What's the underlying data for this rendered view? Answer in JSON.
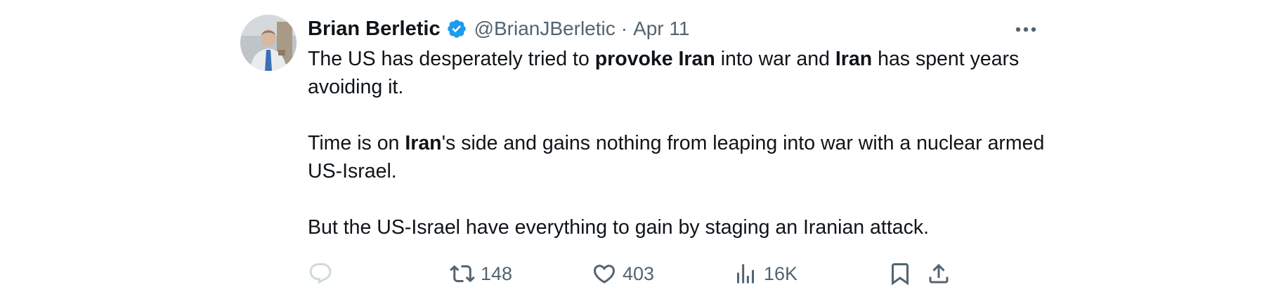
{
  "tweet": {
    "author": {
      "name": "Brian Berletic",
      "handle": "@BrianJBerletic",
      "verified": true
    },
    "separator": "·",
    "date": "Apr 11",
    "body": {
      "p1": {
        "t1": "The US has desperately tried to ",
        "b1": "provoke Iran",
        "t2": " into war and ",
        "b2": "Iran",
        "t3": " has spent years avoiding it."
      },
      "p2": {
        "t1": "Time is on ",
        "b1": "Iran",
        "t2": "'s side and gains nothing from leaping into war with a nuclear armed US-Israel."
      },
      "p3": {
        "t1": "But the US-Israel have everything to gain by staging an Iranian attack."
      }
    },
    "stats": {
      "replies": "",
      "reposts": "148",
      "likes": "403",
      "views": "16K"
    },
    "colors": {
      "text": "#0f1419",
      "secondary": "#536471",
      "verified": "#1d9bf0",
      "reply_icon": "#cfd9de"
    },
    "icons": [
      "verified-badge-icon",
      "more-icon",
      "reply-icon",
      "repost-icon",
      "like-icon",
      "views-icon",
      "bookmark-icon",
      "share-icon"
    ]
  }
}
